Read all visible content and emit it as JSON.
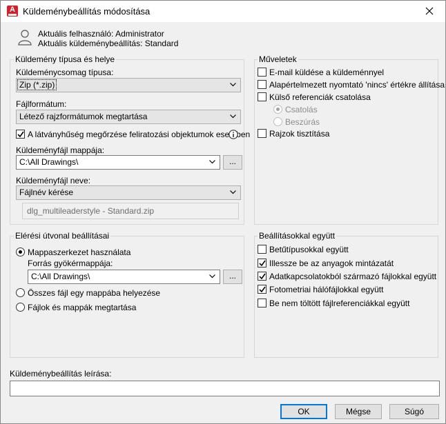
{
  "window": {
    "title": "Küldeménybeállítás módosítása",
    "close_icon": "close-icon"
  },
  "user_info": {
    "current_user": "Aktuális felhasználó: Administrator",
    "current_setup": "Aktuális küldeménybeállítás: Standard"
  },
  "package_type_group": {
    "title": "Küldemény típusa és helye",
    "package_type_label": "Küldeménycsomag típusa:",
    "package_type_value": "Zip (*.zip)",
    "file_format_label": "Fájlformátum:",
    "file_format_value": "Létező rajzformátumok megtartása",
    "maintain_visual_fidelity": "A látványhűség megőrzése feliratozási objektumok esetében",
    "maintain_visual_fidelity_checked": true,
    "folder_label": "Küldeményfájl mappája:",
    "folder_value": "C:\\All Drawings\\",
    "browse": "...",
    "filename_label": "Küldeményfájl neve:",
    "filename_value": "Fájlnév kérése",
    "filename_preview": "dlg_multileaderstyle - Standard.zip"
  },
  "actions_group": {
    "title": "Műveletek",
    "items": [
      {
        "label": "E-mail küldése a küldeménnyel",
        "checked": false
      },
      {
        "label": "Alapértelmezett nyomtató 'nincs' értékre állítása",
        "checked": false
      },
      {
        "label": "Külső referenciák csatolása",
        "checked": false
      }
    ],
    "radios": [
      {
        "label": "Csatolás",
        "selected": true
      },
      {
        "label": "Beszúrás",
        "selected": false
      }
    ],
    "purge": {
      "label": "Rajzok tisztítása",
      "checked": false
    }
  },
  "path_group": {
    "title": "Elérési útvonal beállításai",
    "use_folder_structure": "Mappaszerkezet használata",
    "source_root_label": "Forrás gyökérmappája:",
    "source_root_value": "C:\\All Drawings\\",
    "browse": "...",
    "one_folder": "Összes fájl egy mappába helyezése",
    "keep_files": "Fájlok és mappák megtartása"
  },
  "include_group": {
    "title": "Beállításokkal együtt",
    "items": [
      {
        "label": "Betűtípusokkal együtt",
        "checked": false
      },
      {
        "label": "Illessze be az anyagok mintázatát",
        "checked": true
      },
      {
        "label": "Adatkapcsolatokból származó fájlokkal együtt",
        "checked": true
      },
      {
        "label": "Fotometriai hálófájlokkal együtt",
        "checked": true
      },
      {
        "label": "Be nem töltött fájlreferenciákkal együtt",
        "checked": false
      }
    ]
  },
  "description": {
    "label": "Küldeménybeállítás leírása:",
    "value": ""
  },
  "buttons": {
    "ok": "OK",
    "cancel": "Mégse",
    "help": "Súgó"
  }
}
